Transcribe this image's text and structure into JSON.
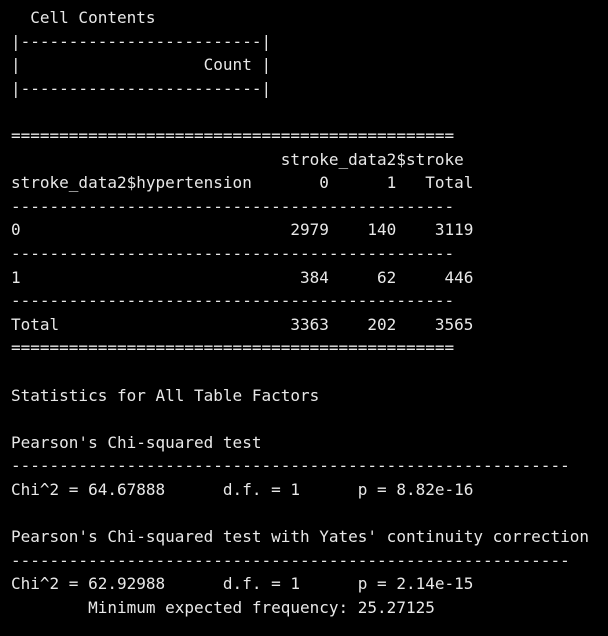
{
  "terminal": {
    "lines": [
      "  Cell Contents",
      "|-------------------------|",
      "|                   Count |",
      "|-------------------------|",
      "",
      "==============================================",
      "                            stroke_data2$stroke",
      "stroke_data2$hypertension       0      1   Total",
      "----------------------------------------------",
      "0                            2979    140    3119",
      "----------------------------------------------",
      "1                             384     62     446",
      "----------------------------------------------",
      "Total                        3363    202    3565",
      "==============================================",
      "",
      "Statistics for All Table Factors",
      "",
      "Pearson's Chi-squared test",
      "----------------------------------------------------------",
      "Chi^2 = 64.67888      d.f. = 1      p = 8.82e-16",
      "",
      "Pearson's Chi-squared test with Yates' continuity correction",
      "----------------------------------------------------------",
      "Chi^2 = 62.92988      d.f. = 1      p = 2.14e-15",
      "        Minimum expected frequency: 25.27125"
    ]
  },
  "colors": {
    "background": "#000000",
    "text": "#e8e8e8"
  }
}
